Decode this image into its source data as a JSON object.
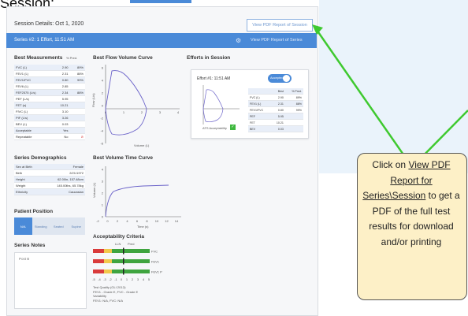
{
  "page_heading_partial": "Session:",
  "session": {
    "title": "Session Details: Oct 1, 2020",
    "pdf_session_label": "View PDF Report of Session"
  },
  "series": {
    "title": "Series #2: 1 Effort, 11:51 AM",
    "pdf_series_label": "View PDF Report of Series",
    "icon": "settings-icon"
  },
  "best_measurements": {
    "title": "Best Measurements",
    "pct_header": "% Pred.",
    "rows": [
      [
        "FVC (L)",
        "2.90",
        "89%"
      ],
      [
        "FEV1 (L)",
        "2.31",
        "88%"
      ],
      [
        "FEV1/FVC",
        "0.80",
        "99%"
      ],
      [
        "FEV6 (L)",
        "2.85",
        ""
      ],
      [
        "FEF2575 (L/s)",
        "2.34",
        "88%"
      ],
      [
        "PEF (L/s)",
        "5.95",
        ""
      ],
      [
        "FET (s)",
        "10.21",
        ""
      ],
      [
        "FIVC (L)",
        "3.10",
        ""
      ],
      [
        "PIF (L/s)",
        "3.26",
        ""
      ],
      [
        "BEV (L)",
        "0.03",
        ""
      ],
      [
        "Acceptable",
        "Yes",
        ""
      ],
      [
        "Repeatable",
        "No",
        ""
      ]
    ]
  },
  "demographics": {
    "title": "Series Demographics",
    "rows": [
      [
        "Sex at Birth",
        "Female"
      ],
      [
        "Birth",
        "2/21/1972"
      ],
      [
        "Height",
        "62.00in, 157.48cm"
      ],
      [
        "Weight",
        "145.00lbs, 65.78kg"
      ],
      [
        "Ethnicity",
        "Caucasian"
      ]
    ]
  },
  "patient_position": {
    "title": "Patient Position",
    "options": [
      "N/A",
      "Standing",
      "Seated",
      "Supine"
    ],
    "selected": "N/A"
  },
  "series_notes": {
    "title": "Series Notes",
    "placeholder": "Post B"
  },
  "flow_volume": {
    "title": "Best Flow Volume Curve",
    "xlabel": "Volume (L)",
    "ylabel": "Flow (L/s)",
    "yticks": [
      "6",
      "4",
      "2",
      "0",
      "-2",
      "-4",
      "-6"
    ],
    "xticks": [
      "0",
      "1",
      "2",
      "3",
      "4"
    ]
  },
  "volume_time": {
    "title": "Best Volume Time Curve",
    "xlabel": "Time (s)",
    "ylabel": "Volume (L)",
    "yticks": [
      "4",
      "3",
      "2",
      "1",
      "0"
    ],
    "xticks": [
      "-2",
      "0",
      "2",
      "4",
      "6",
      "8",
      "10",
      "12",
      "14"
    ]
  },
  "acceptability": {
    "title": "Acceptability Criteria",
    "top_labels": [
      "LLN",
      "Pred"
    ],
    "side_labels": [
      "FVC",
      "FEV1",
      "FEV1 FVC"
    ],
    "zticks": [
      "-5",
      "-4",
      "-3",
      "-2",
      "-1",
      "0",
      "1",
      "2",
      "3",
      "4",
      "5"
    ],
    "quality_lines": [
      "Test Quality (GLI 2012):",
      "FEV1 - Grade E, FVC - Grade E",
      "Variability",
      "FEV1: N/A, FVC: N/A"
    ]
  },
  "efforts": {
    "title": "Efforts in Session",
    "card_title": "Effort #1: 11:51 AM",
    "toggle_label": "Accepted",
    "ats_label": "ATS Acceptability",
    "table_headers": [
      "",
      "Best",
      "% Pred."
    ],
    "rows": [
      [
        "FVC (L)",
        "2.90",
        "89%"
      ],
      [
        "FEV1 (L)",
        "2.31",
        "88%"
      ],
      [
        "FEV1/FVC",
        "0.80",
        "99%"
      ],
      [
        "PEF",
        "5.95",
        ""
      ],
      [
        "FET",
        "10.21",
        ""
      ],
      [
        "BEV",
        "0.03",
        ""
      ]
    ]
  },
  "callout": {
    "pre": "Click on ",
    "link": "View PDF Report for Series\\Session",
    "post": " to get a PDF of the full test results for download and/or printing"
  },
  "colors": {
    "accent": "#4a8ad8",
    "arrow": "#3fc92f",
    "callout_bg": "#fdf0c7",
    "curve": "#6b63c9"
  }
}
